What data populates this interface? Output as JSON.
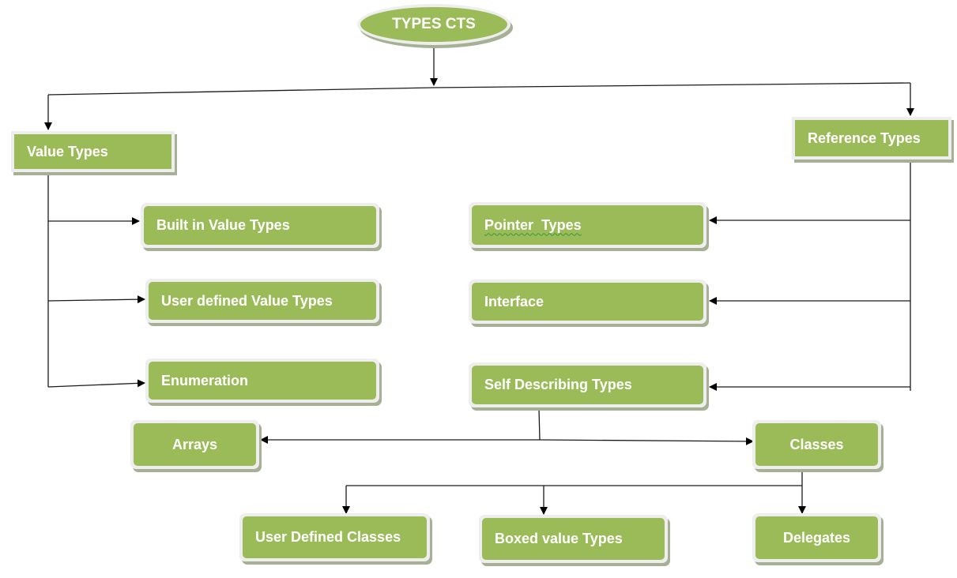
{
  "diagram": {
    "root": {
      "id": "types-cts",
      "label": "TYPES CTS"
    },
    "nodes": [
      {
        "id": "value-types",
        "label": "Value Types"
      },
      {
        "id": "reference-types",
        "label": "Reference Types"
      },
      {
        "id": "built-in-value-types",
        "label": "Built in Value Types"
      },
      {
        "id": "user-defined-value-types",
        "label": "User defined Value Types"
      },
      {
        "id": "enumeration",
        "label": "Enumeration"
      },
      {
        "id": "pointer-types",
        "label": "Pointer  Types"
      },
      {
        "id": "interface",
        "label": "Interface"
      },
      {
        "id": "self-describing-types",
        "label": "Self Describing Types"
      },
      {
        "id": "arrays",
        "label": "Arrays"
      },
      {
        "id": "classes",
        "label": "Classes"
      },
      {
        "id": "user-defined-classes",
        "label": "User Defined Classes"
      },
      {
        "id": "boxed-value-types",
        "label": "Boxed value Types"
      },
      {
        "id": "delegates",
        "label": "Delegates"
      }
    ],
    "edges": [
      {
        "from": "types-cts",
        "to": "value-types"
      },
      {
        "from": "types-cts",
        "to": "reference-types"
      },
      {
        "from": "value-types",
        "to": "built-in-value-types"
      },
      {
        "from": "value-types",
        "to": "user-defined-value-types"
      },
      {
        "from": "value-types",
        "to": "enumeration"
      },
      {
        "from": "reference-types",
        "to": "pointer-types"
      },
      {
        "from": "reference-types",
        "to": "interface"
      },
      {
        "from": "reference-types",
        "to": "self-describing-types"
      },
      {
        "from": "self-describing-types",
        "to": "arrays"
      },
      {
        "from": "self-describing-types",
        "to": "classes"
      },
      {
        "from": "classes",
        "to": "user-defined-classes"
      },
      {
        "from": "classes",
        "to": "boxed-value-types"
      },
      {
        "from": "classes",
        "to": "delegates"
      }
    ],
    "colors": {
      "node_fill": "#9bbb59",
      "node_border": "#eeeeee",
      "node_shadow": "#a6b095",
      "text": "#ffffff",
      "line": "#000000"
    }
  }
}
